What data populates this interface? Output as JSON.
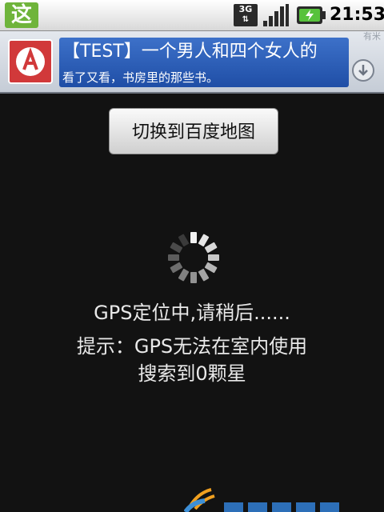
{
  "status_bar": {
    "app_icon_char": "这",
    "network_label": "3G",
    "time": "21:53"
  },
  "ad": {
    "title": "【TEST】一个男人和四个女人的",
    "subtitle": "看了又看，书房里的那些书。",
    "corner_label": "有米",
    "image_icon": "ad-thumbnail-icon",
    "download_icon": "download-icon"
  },
  "main": {
    "switch_button_label": "切换到百度地图",
    "status_line1": "GPS定位中,请稍后......",
    "status_line2": "提示：GPS无法在室内使用",
    "status_line3": "搜索到0颗星"
  },
  "colors": {
    "background": "#121212",
    "ad_accent": "#2f5fb8",
    "status_text": "#e9e9e9",
    "app_icon_bg": "#6fb43b"
  }
}
